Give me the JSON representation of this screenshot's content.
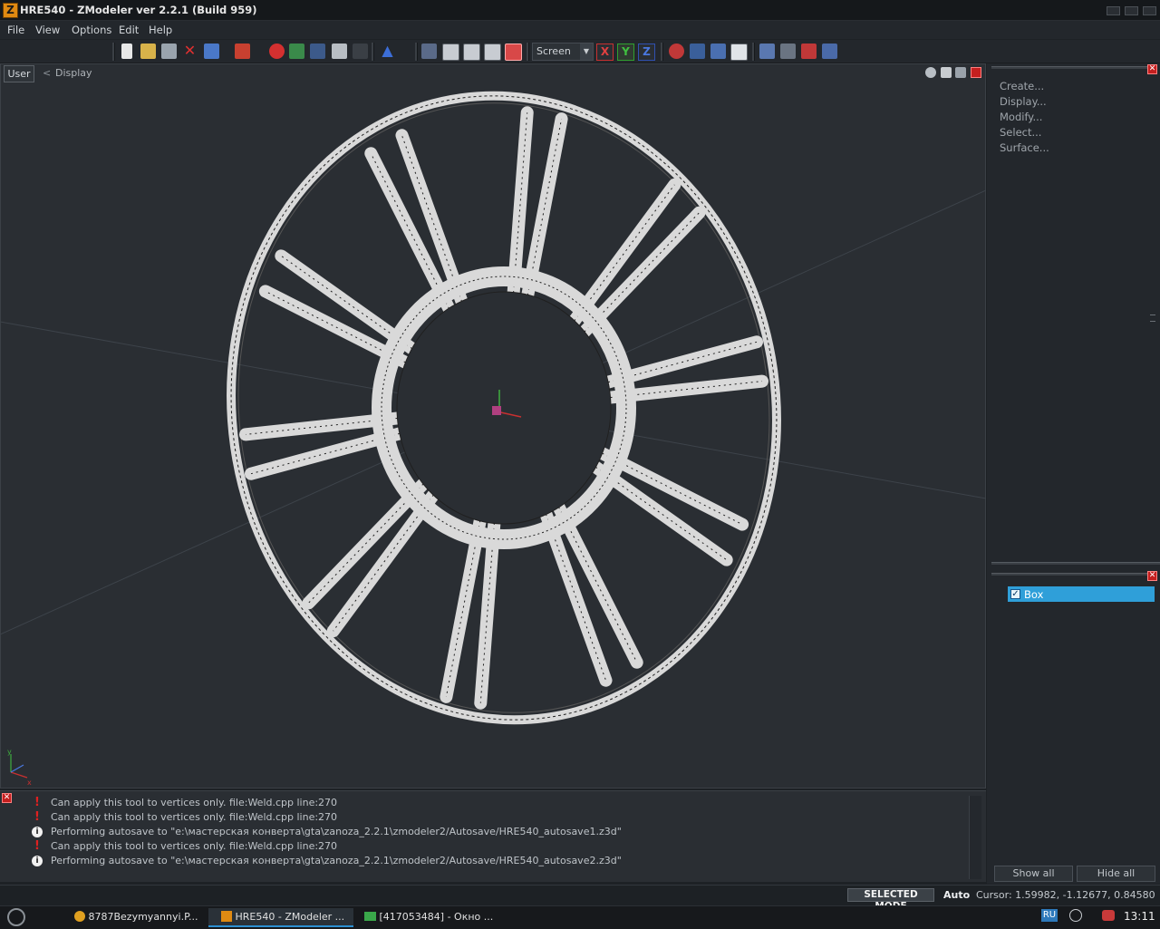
{
  "app": {
    "title": "HRE540 - ZModeler ver 2.2.1 (Build 959)",
    "icon_letter": "Z"
  },
  "menu": [
    {
      "label": "File"
    },
    {
      "label": "View"
    },
    {
      "label": "Options"
    },
    {
      "label": "Edit"
    },
    {
      "label": "Help"
    }
  ],
  "toolbar": {
    "coord_system": "Screen",
    "axes": [
      "X",
      "Y",
      "Z"
    ]
  },
  "viewport": {
    "view_name": "User",
    "back_glyph": "<",
    "mode_label": "Display",
    "gizmo_axes": [
      "y",
      "x"
    ]
  },
  "commands": {
    "items": [
      "Create...",
      "Display...",
      "Modify...",
      "Select...",
      "Surface..."
    ]
  },
  "scene": {
    "items": [
      {
        "label": "Box",
        "checked": true,
        "check_glyph": "✓"
      }
    ],
    "show_all": "Show all",
    "hide_all": "Hide all"
  },
  "log": {
    "lines": [
      {
        "type": "error",
        "text": "Can apply this tool to vertices only. file:Weld.cpp line:270"
      },
      {
        "type": "error",
        "text": "Can apply this tool to vertices only. file:Weld.cpp line:270"
      },
      {
        "type": "info",
        "text": "Performing autosave to \"e:\\мастерская конверта\\gta\\zanoza_2.2.1\\zmodeler2/Autosave/HRE540_autosave1.z3d\""
      },
      {
        "type": "error",
        "text": "Can apply this tool to vertices only. file:Weld.cpp line:270"
      },
      {
        "type": "info",
        "text": "Performing autosave to \"e:\\мастерская конверта\\gta\\zanoza_2.2.1\\zmodeler2/Autosave/HRE540_autosave2.z3d\""
      }
    ]
  },
  "status": {
    "mode": "SELECTED MODE",
    "auto": "Auto",
    "cursor": "Cursor: 1.59982, -1.12677, 0.84580"
  },
  "taskbar": {
    "tasks": [
      {
        "label": "8787Bezymyannyi.P...",
        "active": false
      },
      {
        "label": "HRE540 - ZModeler ...",
        "active": true
      },
      {
        "label": "[417053484] - Окно ...",
        "active": false
      }
    ],
    "lang": "RU",
    "clock": "13:11"
  },
  "colors": {
    "wire_fill": "#d9d9d9",
    "wire_line": "#202020",
    "selection": "#2f9fd9",
    "close_red": "#c41f1f"
  }
}
